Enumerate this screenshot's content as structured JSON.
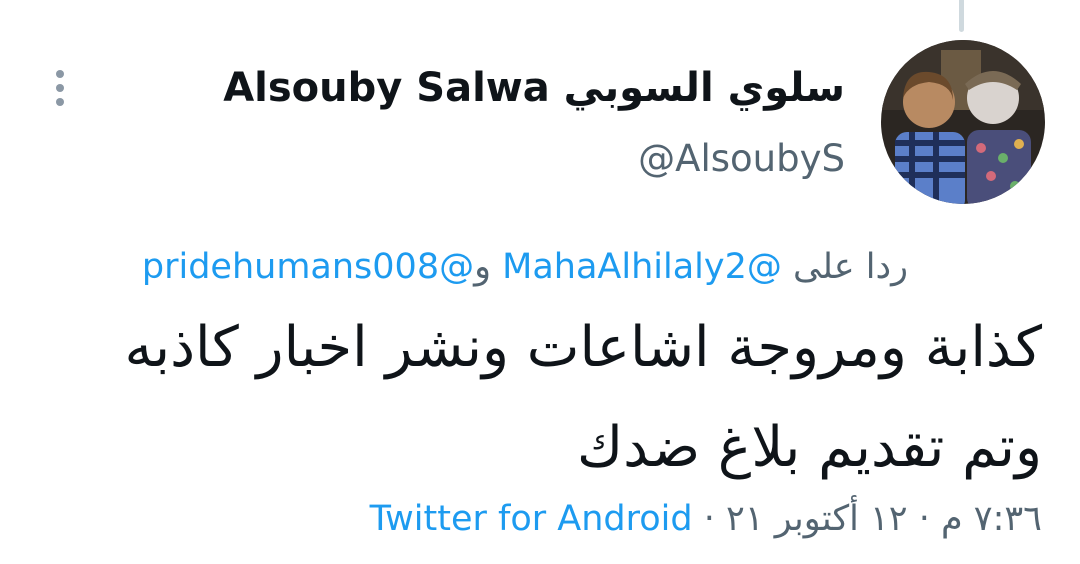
{
  "tweet": {
    "display_name": "سلوي السوبي Alsouby Salwa",
    "handle": "@AlsoubyS",
    "reply_prefix": "ردا على",
    "reply_mention_1": "@MahaAlhilaly2",
    "reply_conjunction": "و",
    "reply_mention_2": "@pridehumans008",
    "text_line_1": "كذابة ومروجة اشاعات ونشر اخبار كاذبه",
    "text_line_2": "وتم تقديم بلاغ ضدك",
    "time": "٧:٣٦ م",
    "separator": "·",
    "date": "١٢ أكتوبر ٢١",
    "source": "Twitter for Android"
  },
  "icons": {
    "more": "more-vertical-icon"
  },
  "colors": {
    "link": "#1d9bf0",
    "secondary_text": "#536471",
    "primary_text": "#0f1419",
    "thread_line": "#cfd9de"
  }
}
